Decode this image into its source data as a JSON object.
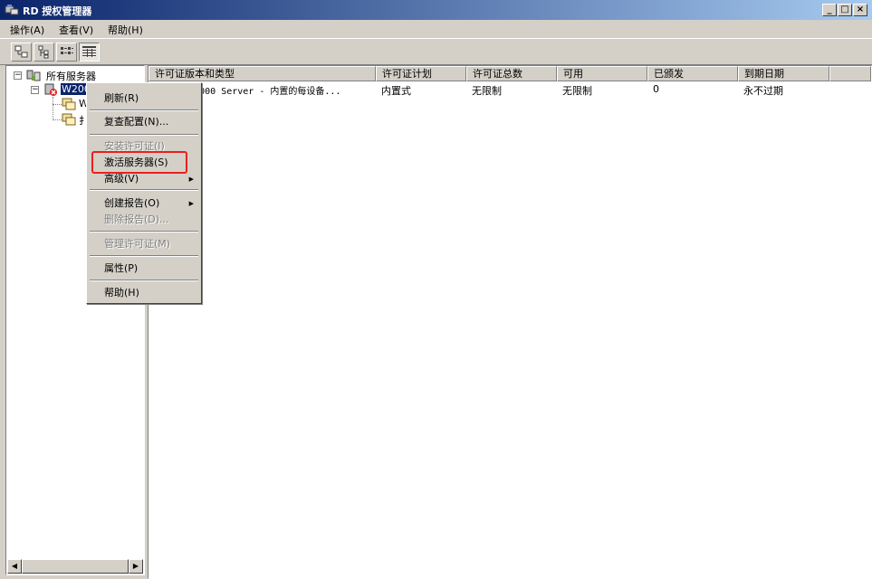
{
  "window": {
    "title": "RD 授权管理器",
    "minimize": "_",
    "maximize": "□",
    "close": "×"
  },
  "menubar": {
    "items": [
      {
        "label": "操作(A)"
      },
      {
        "label": "查看(V)"
      },
      {
        "label": "帮助(H)"
      }
    ]
  },
  "toolbar": {
    "buttons": [
      {
        "icon": "large-icons-view-icon"
      },
      {
        "icon": "small-icons-view-icon"
      },
      {
        "icon": "list-view-icon"
      },
      {
        "icon": "details-view-icon",
        "active": true
      }
    ]
  },
  "tree": {
    "root": "所有服务器",
    "server": "W200",
    "child1": "W",
    "child2": "扌"
  },
  "list": {
    "columns": [
      "许可证版本和类型",
      "许可证计划",
      "许可证总数",
      "可用",
      "已颁发",
      "到期日期"
    ],
    "rows": [
      {
        "cells": [
          "Windows 2000 Server - 内置的每设备...",
          "内置式",
          "无限制",
          "无限制",
          "0",
          "永不过期"
        ],
        "visible_name": "...s 2000 Server - 内置的每设备..."
      }
    ]
  },
  "context_menu": {
    "items": [
      {
        "label": "刷新(R)",
        "enabled": true
      },
      {
        "label": "复查配置(N)...",
        "enabled": true
      },
      {
        "label": "安装许可证(I)",
        "enabled": false
      },
      {
        "label": "激活服务器(S)",
        "enabled": true,
        "highlighted": true
      },
      {
        "label": "高级(V)",
        "enabled": true,
        "submenu": true
      },
      {
        "label": "创建报告(O)",
        "enabled": true,
        "submenu": true
      },
      {
        "label": "删除报告(D)...",
        "enabled": false
      },
      {
        "label": "管理许可证(M)",
        "enabled": false
      },
      {
        "label": "属性(P)",
        "enabled": true
      },
      {
        "label": "帮助(H)",
        "enabled": true
      }
    ]
  },
  "colors": {
    "title_start": "#0a246a",
    "title_end": "#a6caf0",
    "face": "#d4d0c8",
    "selection": "#0a246a",
    "callout": "#e8201f"
  }
}
